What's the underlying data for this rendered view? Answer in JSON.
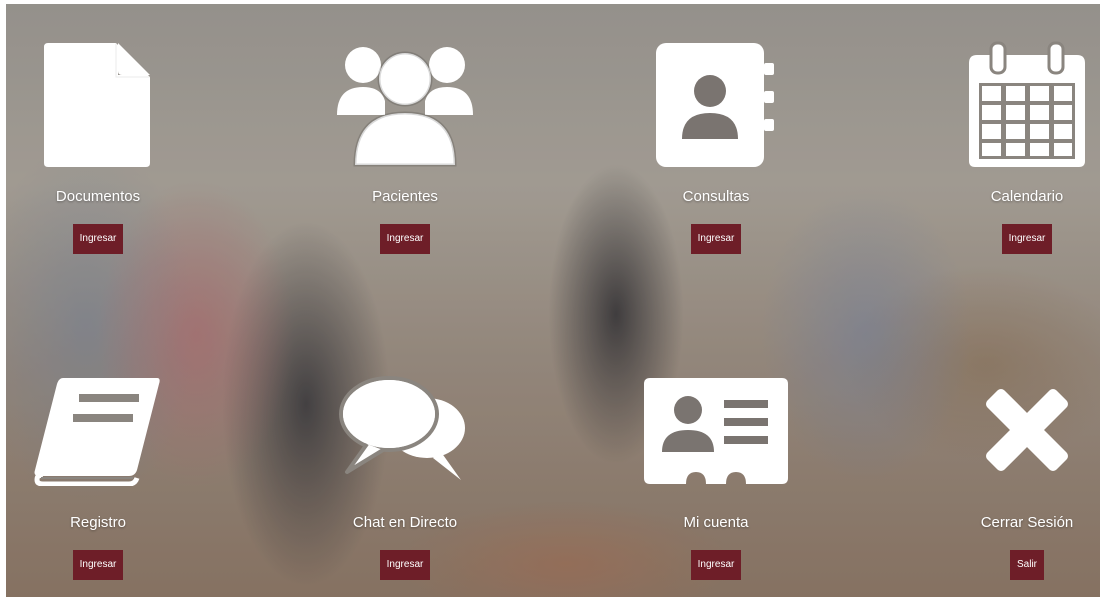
{
  "tiles": [
    {
      "label": "Documentos",
      "button": "Ingresar",
      "icon": "document-icon"
    },
    {
      "label": "Pacientes",
      "button": "Ingresar",
      "icon": "patients-group-icon"
    },
    {
      "label": "Consultas",
      "button": "Ingresar",
      "icon": "contact-book-icon"
    },
    {
      "label": "Calendario",
      "button": "Ingresar",
      "icon": "calendar-icon"
    },
    {
      "label": "Registro",
      "button": "Ingresar",
      "icon": "book-icon"
    },
    {
      "label": "Chat en Directo",
      "button": "Ingresar",
      "icon": "chat-bubbles-icon"
    },
    {
      "label": "Mi cuenta",
      "button": "Ingresar",
      "icon": "id-card-icon"
    },
    {
      "label": "Cerrar Sesión",
      "button": "Salir",
      "icon": "close-x-icon"
    }
  ],
  "colors": {
    "button_background": "#6e1e28",
    "icon_fill": "#ffffff"
  }
}
